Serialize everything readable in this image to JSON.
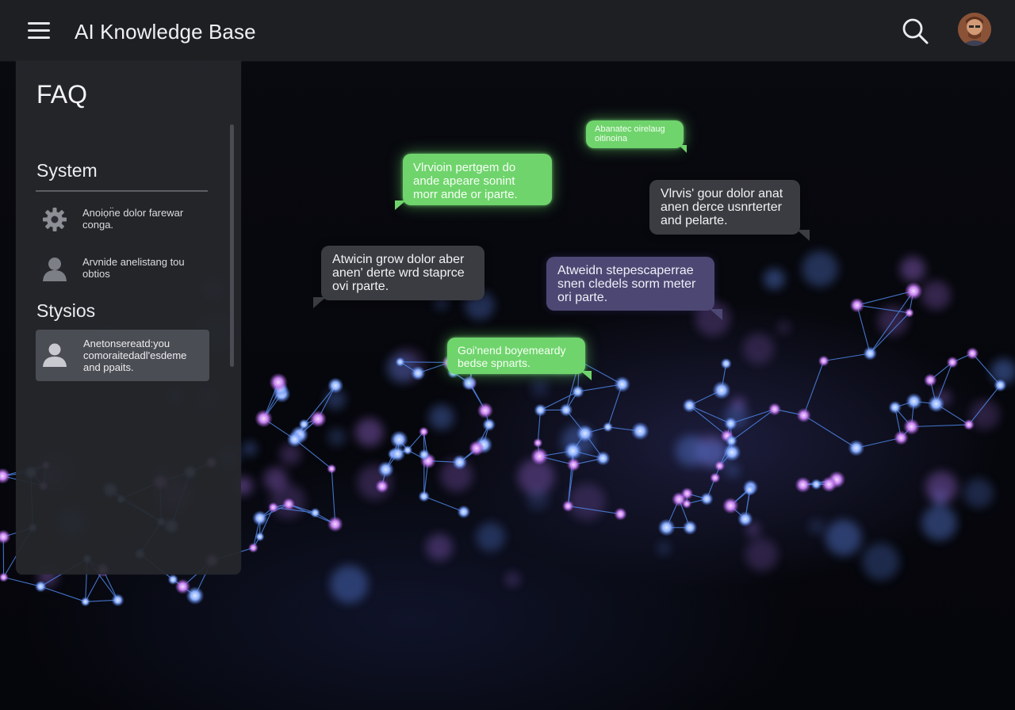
{
  "header": {
    "title": "AI Knowledge Base",
    "menu_icon": "hamburger-menu-icon",
    "search_icon": "search-icon",
    "avatar": "user-avatar"
  },
  "sidebar": {
    "title": "FAQ",
    "sections": [
      {
        "heading": "System",
        "items": [
          {
            "icon": "gear-icon",
            "text": "Anoiọn̈e dolor farewar conga."
          },
          {
            "icon": "person-icon",
            "text": "Arvnide anelistanɡ tou obtios"
          }
        ]
      },
      {
        "heading": "Stysios",
        "items": [
          {
            "icon": "person-icon",
            "text": "Anetonsereatd:you comoraitedadl'esdeme and ppaits.",
            "active": true
          }
        ]
      }
    ]
  },
  "chat_bubbles": [
    {
      "style": "green",
      "text": "Abanatec oirelaug oitinoina"
    },
    {
      "style": "green",
      "text": "Vlrvioin pertgem do ande apeare sonint morr ande or iparte."
    },
    {
      "style": "dark",
      "text": "Vlrvis' gour dolor anat anen derce usnrterter and pelarte."
    },
    {
      "style": "dark",
      "text": "Atwicin grow dolor aber anen' derte wrd staprce ovi rparte."
    },
    {
      "style": "purple",
      "text": "Atweidn stepescaperrae snen cledels sorm meter ori parte."
    },
    {
      "style": "green",
      "text": "Goi'nend boyemeardy bedse spnarts."
    }
  ],
  "colors": {
    "header_bg": "#1d1f23",
    "sidebar_bg": "#25272c",
    "bubble_green": "#6fd46c",
    "bubble_dark": "#3a3c41",
    "bubble_purple": "#4c4873",
    "network_blue": "#5a8cff",
    "network_violet": "#c27cf0"
  }
}
